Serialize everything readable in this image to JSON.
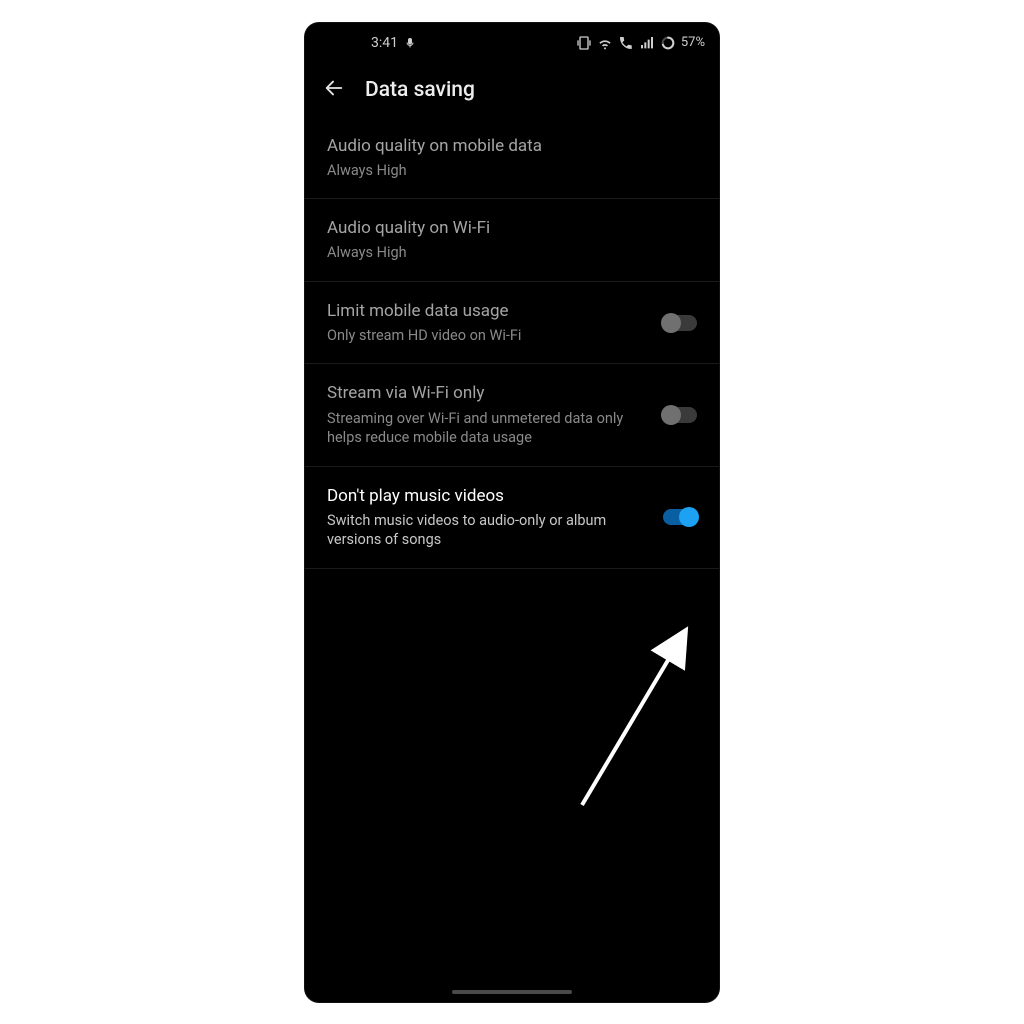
{
  "status_bar": {
    "time": "3:41",
    "battery_text": "57%"
  },
  "header": {
    "title": "Data saving"
  },
  "settings": [
    {
      "key": "audio-mobile",
      "title": "Audio quality on mobile data",
      "subtitle": "Always High",
      "has_toggle": false,
      "toggle_on": false,
      "highlight": false
    },
    {
      "key": "audio-wifi",
      "title": "Audio quality on Wi-Fi",
      "subtitle": "Always High",
      "has_toggle": false,
      "toggle_on": false,
      "highlight": false
    },
    {
      "key": "limit-mobile",
      "title": "Limit mobile data usage",
      "subtitle": "Only stream HD video on Wi-Fi",
      "has_toggle": true,
      "toggle_on": false,
      "highlight": false
    },
    {
      "key": "stream-wifi-only",
      "title": "Stream via Wi-Fi only",
      "subtitle": "Streaming over Wi-Fi and unmetered data only helps reduce mobile data usage",
      "has_toggle": true,
      "toggle_on": false,
      "highlight": false
    },
    {
      "key": "dont-play-mv",
      "title": "Don't play music videos",
      "subtitle": "Switch music videos to audio-only or album versions of songs",
      "has_toggle": true,
      "toggle_on": true,
      "highlight": true
    }
  ],
  "colors": {
    "accent": "#1da1f2"
  }
}
